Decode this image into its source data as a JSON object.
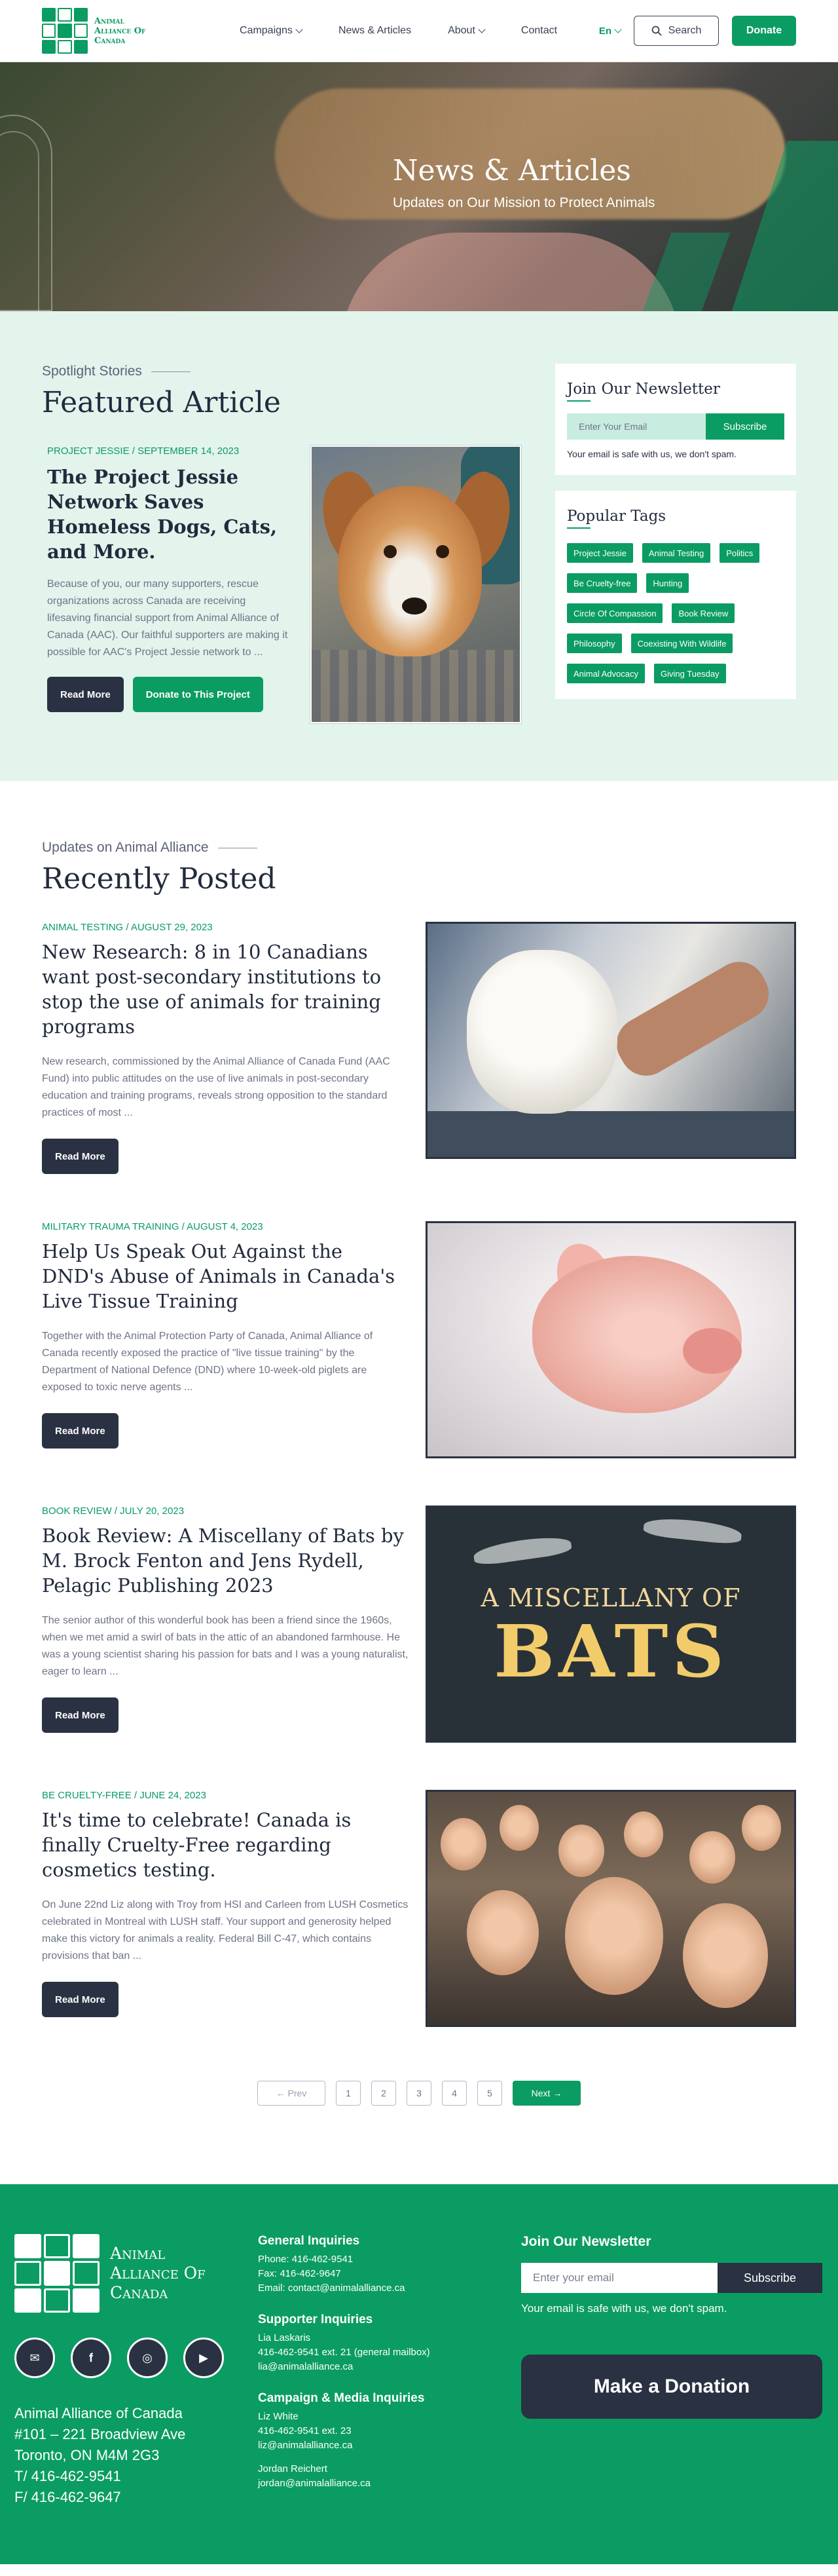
{
  "header": {
    "logo_text": "Animal Alliance Of Canada",
    "nav": [
      "Campaigns",
      "News & Articles",
      "About",
      "Contact"
    ],
    "language": "En",
    "search_label": "Search",
    "donate_label": "Donate"
  },
  "hero": {
    "title": "News & Articles",
    "subtitle": "Updates on Our Mission to Protect Animals"
  },
  "featured": {
    "kicker": "Spotlight Stories",
    "title": "Featured Article",
    "meta": "PROJECT JESSIE / SEPTEMBER 14, 2023",
    "post_title": "The Project Jessie Network Saves Homeless Dogs, Cats, and More.",
    "excerpt": "Because of you, our many supporters, rescue organizations across Canada are receiving lifesaving financial support from Animal Alliance of Canada (AAC). Our faithful supporters are making it possible for AAC's Project Jessie network to ...",
    "read_more": "Read More",
    "donate_project": "Donate to This Project"
  },
  "newsletter": {
    "title": "Join Our Newsletter",
    "placeholder": "Enter Your Email",
    "button": "Subscribe",
    "note": "Your email is safe with us, we don't spam."
  },
  "tags": {
    "title": "Popular Tags",
    "items": [
      "Project Jessie",
      "Animal Testing",
      "Politics",
      "Be Cruelty-free",
      "Hunting",
      "Circle Of Compassion",
      "Book Review",
      "Philosophy",
      "Coexisting With Wildlife",
      "Animal Advocacy",
      "Giving Tuesday"
    ]
  },
  "recent": {
    "kicker": "Updates on Animal Alliance",
    "title": "Recently Posted",
    "posts": [
      {
        "meta": "ANIMAL TESTING / AUGUST 29, 2023",
        "title": "New Research: 8 in 10 Canadians want post-secondary institutions to stop the use of animals for training programs",
        "excerpt": "New research, commissioned by the Animal Alliance of Canada Fund (AAC Fund) into public attitudes on the use of live animals in post-secondary education and training programs, reveals strong opposition to the standard practices of most ...",
        "button": "Read More"
      },
      {
        "meta": "MILITARY TRAUMA TRAINING / AUGUST 4, 2023",
        "title": "Help Us Speak Out Against the DND's Abuse of Animals in Canada's Live Tissue Training",
        "excerpt": "Together with the Animal Protection Party of Canada, Animal Alliance of Canada recently exposed the practice of \"live tissue training\" by the Department of National Defence (DND) where 10-week-old piglets are exposed to toxic nerve agents ...",
        "button": "Read More"
      },
      {
        "meta": "BOOK REVIEW / JULY 20, 2023",
        "title": "Book Review: A Miscellany of Bats by M. Brock Fenton and Jens Rydell, Pelagic Publishing 2023",
        "excerpt": "The senior author of this wonderful book has been a friend since the 1960s, when we met amid a swirl of bats in the attic of an abandoned farmhouse. He was a young scientist sharing his passion for bats and I was a young naturalist, eager to learn ...",
        "button": "Read More",
        "image_text_1": "A MISCELLANY OF",
        "image_text_2": "BATS"
      },
      {
        "meta": "BE CRUELTY-FREE / JUNE 24, 2023",
        "title": "It's time to celebrate! Canada is finally Cruelty-Free regarding cosmetics testing.",
        "excerpt": "On June 22nd Liz along with Troy from HSI and Carleen from LUSH Cosmetics celebrated in Montreal with LUSH staff. Your support and generosity helped make this victory for animals a reality. Federal Bill C-47, which contains provisions that ban ...",
        "button": "Read More"
      }
    ]
  },
  "pagination": {
    "prev": "← Prev",
    "pages": [
      "1",
      "2",
      "3",
      "4",
      "5"
    ],
    "next": "Next →"
  },
  "footer": {
    "logo_text": "Animal Alliance Of Canada",
    "address": [
      "Animal Alliance of Canada",
      "#101 – 221 Broadview Ave",
      "Toronto, ON M4M 2G3",
      "T/  416-462-9541",
      "F/  416-462-9647"
    ],
    "general_title": "General Inquiries",
    "general": [
      "Phone: 416-462-9541",
      "Fax: 416-462-9647",
      "Email: contact@animalalliance.ca"
    ],
    "supporter_title": "Supporter Inquiries",
    "supporter": [
      "Lia Laskaris",
      "416-462-9541 ext. 21 (general mailbox)",
      "lia@animalalliance.ca"
    ],
    "campaign_title": "Campaign & Media Inquiries",
    "campaign": [
      "Liz White",
      "416-462-9541 ext. 23",
      "liz@animalalliance.ca"
    ],
    "campaign2": [
      "Jordan Reichert",
      "jordan@animalalliance.ca"
    ],
    "newsletter_title": "Join Our Newsletter",
    "newsletter_placeholder": "Enter your email",
    "newsletter_button": "Subscribe",
    "newsletter_note": "Your email is safe with us, we don't spam.",
    "make_donation": "Make a Donation"
  }
}
